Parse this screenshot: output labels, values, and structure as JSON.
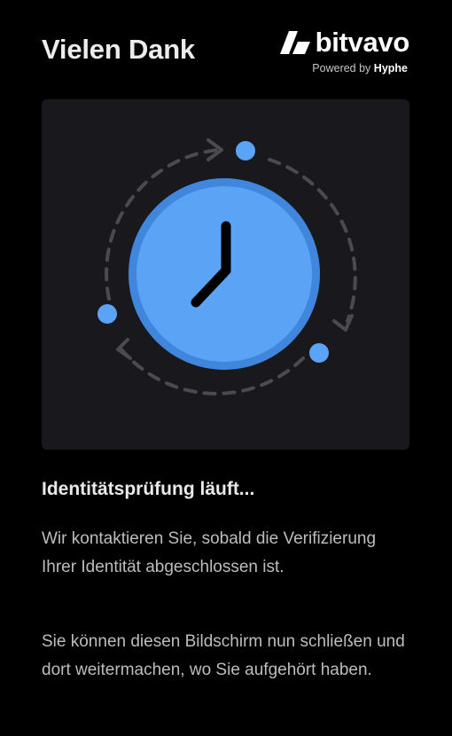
{
  "header": {
    "title": "Vielen Dank",
    "brand": {
      "name": "bitvavo",
      "powered_by": "Powered by",
      "partner": "Hyphe",
      "logo_icon": "bitvavo-logo-icon"
    }
  },
  "illustration": {
    "icon": "clock-icon",
    "cycle_arrows_icon": "cycle-arrows-icon",
    "colors": {
      "card_background": "#19191d",
      "clock_face": "#5ba3f5",
      "clock_ring": "#3f86dc",
      "dots": "#5ba3f5",
      "dashes": "#4a4a50"
    }
  },
  "content": {
    "heading": "Identitätsprüfung läuft...",
    "paragraph_1": "Wir kontaktieren Sie, sobald die Verifizierung Ihrer Identität abgeschlossen ist.",
    "paragraph_2": "Sie können diesen Bildschirm nun schließen und dort weitermachen, wo Sie aufgehört haben."
  },
  "colors": {
    "background": "#000000",
    "text_primary": "#ececec",
    "text_secondary": "#bdbdbd"
  }
}
